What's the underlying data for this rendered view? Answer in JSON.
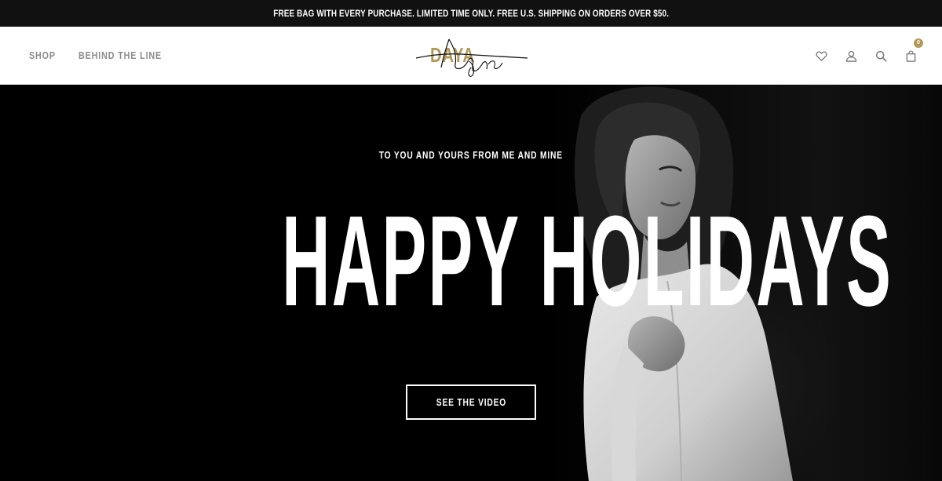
{
  "announcement": "FREE BAG WITH EVERY PURCHASE. LIMITED TIME ONLY. FREE U.S. SHIPPING ON ORDERS OVER $50.",
  "nav": [
    {
      "label": "SHOP"
    },
    {
      "label": "BEHIND THE LINE"
    }
  ],
  "logo": {
    "text": "DAYA"
  },
  "icons": [
    "heart-icon",
    "account-icon",
    "search-icon",
    "bag-icon"
  ],
  "cart": {
    "count": "0"
  },
  "hero": {
    "subtitle": "TO YOU AND YOURS FROM ME AND MINE",
    "headline": "HAPPY HOLIDAYS",
    "cta": "SEE THE VIDEO"
  },
  "colors": {
    "accent": "#b39a5b",
    "announcement_bg": "#111111",
    "hero_bg": "#000000",
    "nav_text": "#8c8c8c"
  }
}
